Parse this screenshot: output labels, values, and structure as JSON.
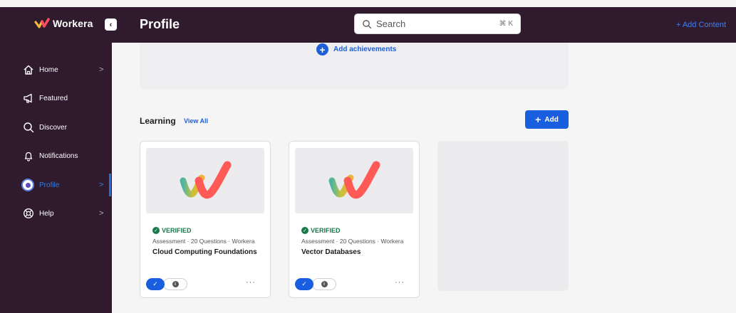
{
  "app": {
    "brand_name": "Workera",
    "page_title": "Profile"
  },
  "header": {
    "search": {
      "placeholder": "Search",
      "shortcut": "⌘ K"
    },
    "add_content_label": "+ Add Content",
    "collapse_icon": "chevron-left-icon"
  },
  "sidebar": {
    "items": [
      {
        "label": "Home",
        "icon": "home-icon",
        "has_chevron": true,
        "active": false
      },
      {
        "label": "Featured",
        "icon": "megaphone-icon",
        "has_chevron": false,
        "active": false
      },
      {
        "label": "Discover",
        "icon": "search-icon",
        "has_chevron": false,
        "active": false
      },
      {
        "label": "Notifications",
        "icon": "bell-icon",
        "has_chevron": false,
        "active": false
      },
      {
        "label": "Profile",
        "icon": "avatar",
        "has_chevron": true,
        "active": true
      },
      {
        "label": "Help",
        "icon": "lifebuoy-icon",
        "has_chevron": true,
        "active": false
      }
    ],
    "chevron": ">"
  },
  "achievements": {
    "add_label": "Add achievements"
  },
  "learning": {
    "title": "Learning",
    "view_all_label": "View All",
    "add_label": "Add",
    "cards": [
      {
        "status": "VERIFIED",
        "meta": "Assessment · 20 Questions · Workera",
        "title": "Cloud Computing Foundations"
      },
      {
        "status": "VERIFIED",
        "meta": "Assessment · 20 Questions · Workera",
        "title": "Vector Databases"
      }
    ]
  },
  "colors": {
    "sidebar_bg": "#2f1a2e",
    "accent_blue": "#1a5ee0",
    "verified_green": "#17794a",
    "page_bg": "#f5f5f6"
  }
}
